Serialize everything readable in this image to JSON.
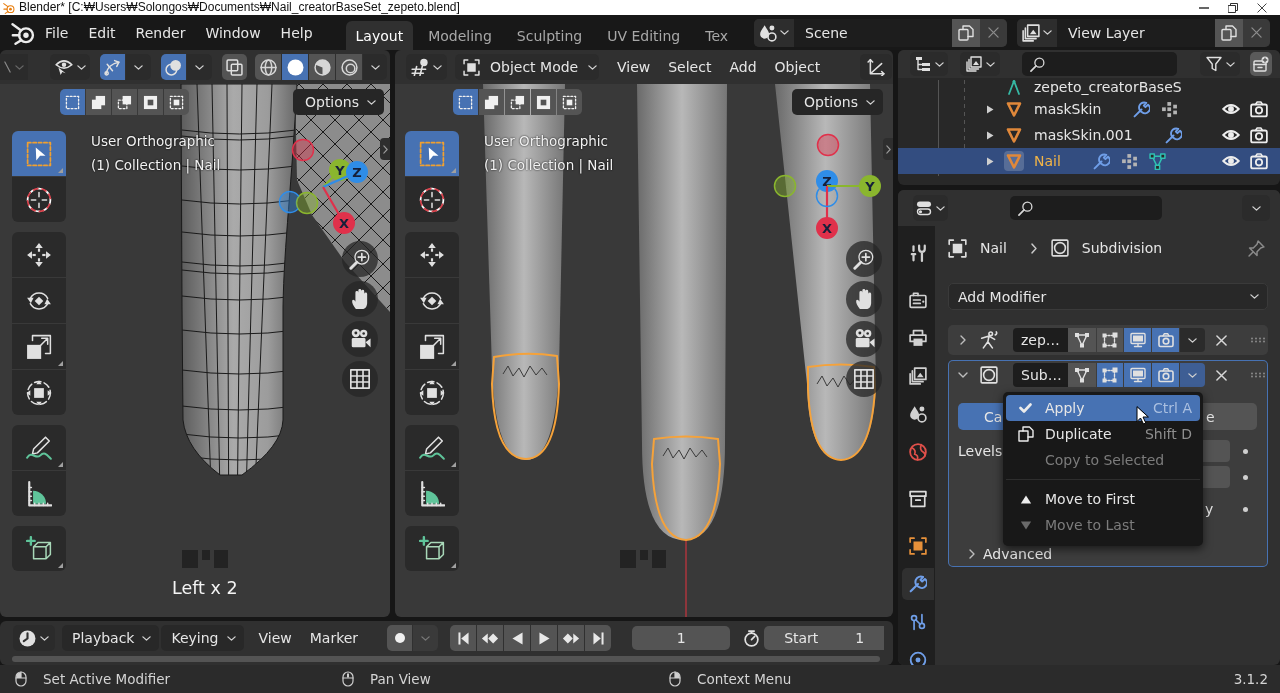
{
  "window": {
    "title": "Blender* [C:₩Users₩Solongos₩Documents₩Nail_creatorBaseSet_zepeto.blend]"
  },
  "top_bar": {
    "menus": [
      "File",
      "Edit",
      "Render",
      "Window",
      "Help"
    ],
    "workspaces": [
      {
        "label": "Layout",
        "selected": true
      },
      {
        "label": "Modeling",
        "selected": false
      },
      {
        "label": "Sculpting",
        "selected": false
      },
      {
        "label": "UV Editing",
        "selected": false
      },
      {
        "label": "Tex",
        "selected": false
      }
    ],
    "scene": "Scene",
    "view_layer": "View Layer"
  },
  "left_viewport": {
    "toggles": [
      {
        "kind": "gizmo",
        "on": true
      },
      {
        "kind": "overlay",
        "on": true
      },
      {
        "kind": "xray",
        "on": false
      }
    ],
    "shading": [
      {
        "kind": "wireframe",
        "selected": false
      },
      {
        "kind": "solid",
        "selected": true
      },
      {
        "kind": "material",
        "selected": false
      },
      {
        "kind": "rendered",
        "selected": false
      }
    ],
    "select_modes": [
      {
        "kind": "set",
        "selected": true
      },
      {
        "kind": "extend",
        "selected": false
      },
      {
        "kind": "subtract",
        "selected": false
      },
      {
        "kind": "invert",
        "selected": false
      },
      {
        "kind": "intersect",
        "selected": false
      }
    ],
    "options": "Options",
    "view_name": "User Orthographic",
    "info": "(1) Collection | Nail",
    "tool_groups": [
      [
        {
          "kind": "select",
          "selected": true,
          "variants": true
        },
        {
          "kind": "cursor",
          "selected": false,
          "variants": false
        }
      ],
      [
        {
          "kind": "move",
          "selected": false,
          "variants": false
        },
        {
          "kind": "rotate",
          "selected": false,
          "variants": false
        },
        {
          "kind": "scale",
          "selected": false,
          "variants": true
        },
        {
          "kind": "transform",
          "selected": false,
          "variants": false
        }
      ],
      [
        {
          "kind": "annotate",
          "selected": false,
          "variants": true
        },
        {
          "kind": "measure",
          "selected": false,
          "variants": false
        }
      ],
      [
        {
          "kind": "add",
          "selected": false,
          "variants": true
        }
      ]
    ],
    "axes": [
      {
        "label": "Y",
        "color": "#8ab62e"
      },
      {
        "label": "Z",
        "color": "#2f8de8"
      },
      {
        "label": "X",
        "color": "#e0314b"
      }
    ],
    "keystroke": "Left x 2"
  },
  "main_viewport": {
    "mode": "Object Mode",
    "menus": [
      "View",
      "Select",
      "Add",
      "Object"
    ],
    "select_modes": [
      {
        "kind": "set",
        "selected": true
      },
      {
        "kind": "extend",
        "selected": false
      },
      {
        "kind": "subtract",
        "selected": false
      },
      {
        "kind": "invert",
        "selected": false
      },
      {
        "kind": "intersect",
        "selected": false
      }
    ],
    "options": "Options",
    "view_name": "User Orthographic",
    "info": "(1) Collection | Nail",
    "tool_groups": [
      [
        {
          "kind": "select",
          "selected": true,
          "variants": true
        },
        {
          "kind": "cursor",
          "selected": false,
          "variants": false
        }
      ],
      [
        {
          "kind": "move",
          "selected": false,
          "variants": false
        },
        {
          "kind": "rotate",
          "selected": false,
          "variants": false
        },
        {
          "kind": "scale",
          "selected": false,
          "variants": true
        },
        {
          "kind": "transform",
          "selected": false,
          "variants": false
        }
      ],
      [
        {
          "kind": "annotate",
          "selected": false,
          "variants": true
        },
        {
          "kind": "measure",
          "selected": false,
          "variants": false
        }
      ],
      [
        {
          "kind": "add",
          "selected": false,
          "variants": true
        }
      ]
    ],
    "axes": [
      {
        "label": "Z",
        "color": "#2f8de8"
      },
      {
        "label": "Y",
        "color": "#8ab62e"
      },
      {
        "label": "X",
        "color": "#e0314b"
      }
    ]
  },
  "outliner": {
    "rows": [
      {
        "kind": "armature",
        "name": "zepeto_creatorBaseS",
        "selected": false
      },
      {
        "kind": "mesh",
        "name": "maskSkin",
        "selected": false,
        "data": [
          {
            "kind": "modifiers"
          },
          {
            "kind": "vertex_groups"
          }
        ],
        "visible": true,
        "renderable": true
      },
      {
        "kind": "mesh",
        "name": "maskSkin.001",
        "selected": false,
        "data": [
          {
            "kind": "modifiers"
          }
        ],
        "visible": true,
        "renderable": true
      },
      {
        "kind": "mesh",
        "name": "Nail",
        "selected": true,
        "data": [
          {
            "kind": "modifiers"
          },
          {
            "kind": "vertex_groups"
          },
          {
            "kind": "mesh_data"
          }
        ],
        "visible": true,
        "renderable": true
      }
    ]
  },
  "properties": {
    "tab_groups": [
      [
        {
          "kind": "tool",
          "selected": false
        }
      ],
      [
        {
          "kind": "render",
          "selected": false
        },
        {
          "kind": "output",
          "selected": false
        },
        {
          "kind": "view_layer",
          "selected": false
        },
        {
          "kind": "scene",
          "selected": false
        },
        {
          "kind": "world",
          "selected": false
        }
      ],
      [
        {
          "kind": "collection",
          "selected": false
        }
      ],
      [
        {
          "kind": "object",
          "selected": false
        },
        {
          "kind": "modifiers",
          "selected": true
        },
        {
          "kind": "particles",
          "selected": false
        },
        {
          "kind": "physics",
          "selected": false
        }
      ]
    ],
    "breadcrumb": {
      "object": "Nail",
      "modifier": "Subdivision"
    },
    "add_modifier": "Add Modifier",
    "modifiers": [
      {
        "kind": "armature",
        "name": "zep…",
        "expanded": false,
        "active": false,
        "edit_mode": false,
        "on_cage": false,
        "viewport": true,
        "render": true,
        "menu_open": false
      },
      {
        "kind": "subdivision",
        "name": "Sub…",
        "expanded": true,
        "active": true,
        "edit_mode": false,
        "on_cage": true,
        "viewport": true,
        "render": true,
        "menu_open": true,
        "panel": {
          "types": [
            {
              "label": "Ca",
              "selected": true
            },
            {
              "label": "e",
              "selected": false
            }
          ],
          "levels_label": "Levels",
          "option_label": "y",
          "advanced": {
            "label": "Advanced",
            "expanded": false
          }
        }
      }
    ]
  },
  "context_menu": {
    "groups": [
      [
        {
          "kind": "apply",
          "label": "Apply",
          "shortcut": "Ctrl A",
          "highlighted": true,
          "disabled": false
        },
        {
          "kind": "duplicate",
          "label": "Duplicate",
          "shortcut": "Shift D",
          "highlighted": false,
          "disabled": false
        },
        {
          "kind": "copy",
          "label": "Copy to Selected",
          "highlighted": false,
          "disabled": true
        }
      ],
      [
        {
          "kind": "move_first",
          "label": "Move to First",
          "highlighted": false,
          "disabled": false
        },
        {
          "kind": "move_last",
          "label": "Move to Last",
          "highlighted": false,
          "disabled": true
        }
      ]
    ]
  },
  "timeline": {
    "dropdowns": [
      "Playback",
      "Keying"
    ],
    "menus": [
      "View",
      "Marker"
    ],
    "auto_keying": false,
    "current_frame": "1",
    "start": {
      "label": "Start",
      "value": "1"
    }
  },
  "status_bar": {
    "hints": [
      {
        "kind": "left",
        "label": "Set Active Modifier"
      },
      {
        "kind": "middle",
        "label": "Pan View"
      },
      {
        "kind": "right",
        "label": "Context Menu"
      }
    ],
    "version": "3.1.2"
  }
}
